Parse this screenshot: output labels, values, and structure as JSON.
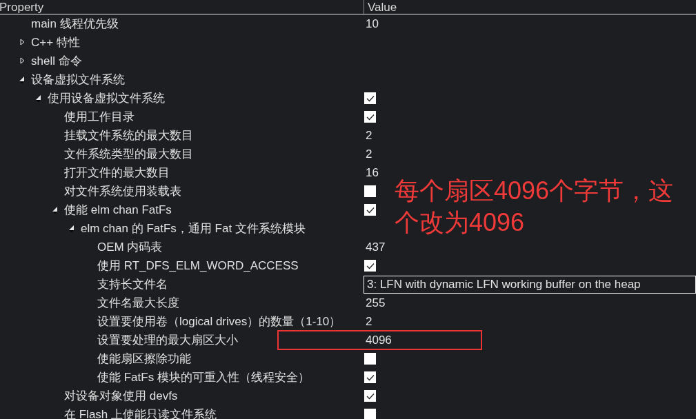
{
  "header": {
    "columns": [
      "Property",
      "Value"
    ]
  },
  "tree": [
    {
      "label": "main 线程优先级",
      "value": {
        "kind": "text",
        "text": "10"
      }
    },
    {
      "label": "C++ 特性",
      "expanded": false
    },
    {
      "label": "shell 命令",
      "expanded": false
    },
    {
      "label": "设备虚拟文件系统",
      "expanded": true,
      "children": [
        {
          "label": "使用设备虚拟文件系统",
          "expanded": true,
          "value": {
            "kind": "checkbox",
            "checked": true
          },
          "children": [
            {
              "label": "使用工作目录",
              "value": {
                "kind": "checkbox",
                "checked": true
              }
            },
            {
              "label": "挂载文件系统的最大数目",
              "value": {
                "kind": "text",
                "text": "2"
              }
            },
            {
              "label": "文件系统类型的最大数目",
              "value": {
                "kind": "text",
                "text": "2"
              }
            },
            {
              "label": "打开文件的最大数目",
              "value": {
                "kind": "text",
                "text": "16"
              }
            },
            {
              "label": "对文件系统使用装载表",
              "value": {
                "kind": "checkbox",
                "checked": false
              }
            },
            {
              "label": "使能 elm chan FatFs",
              "expanded": true,
              "value": {
                "kind": "checkbox",
                "checked": true
              },
              "children": [
                {
                  "label": "elm chan 的 FatFs，通用 Fat 文件系统模块",
                  "expanded": true,
                  "children": [
                    {
                      "label": "OEM 内码表",
                      "value": {
                        "kind": "text",
                        "text": "437"
                      }
                    },
                    {
                      "label": "使用 RT_DFS_ELM_WORD_ACCESS",
                      "value": {
                        "kind": "checkbox",
                        "checked": true
                      }
                    },
                    {
                      "label": "支持长文件名",
                      "value": {
                        "kind": "dropdown",
                        "text": "3: LFN with dynamic LFN working buffer on the heap"
                      }
                    },
                    {
                      "label": "文件名最大长度",
                      "value": {
                        "kind": "text",
                        "text": "255"
                      }
                    },
                    {
                      "label": "设置要使用卷（logical drives）的数量（1-10）",
                      "value": {
                        "kind": "text",
                        "text": "2"
                      }
                    },
                    {
                      "label": "设置要处理的最大扇区大小",
                      "value": {
                        "kind": "text",
                        "text": "4096"
                      }
                    },
                    {
                      "label": "使能扇区擦除功能",
                      "value": {
                        "kind": "checkbox",
                        "checked": false
                      }
                    },
                    {
                      "label": "使能 FatFs 模块的可重入性（线程安全）",
                      "value": {
                        "kind": "checkbox",
                        "checked": true
                      }
                    }
                  ]
                }
              ]
            },
            {
              "label": "对设备对象使用 devfs",
              "value": {
                "kind": "checkbox",
                "checked": true
              }
            },
            {
              "label": "在 Flash 上使能只读文件系统",
              "value": {
                "kind": "checkbox",
                "checked": false
              }
            }
          ]
        }
      ]
    }
  ],
  "annotation": {
    "text": "每个扇区4096个字节，这个改为4096"
  }
}
